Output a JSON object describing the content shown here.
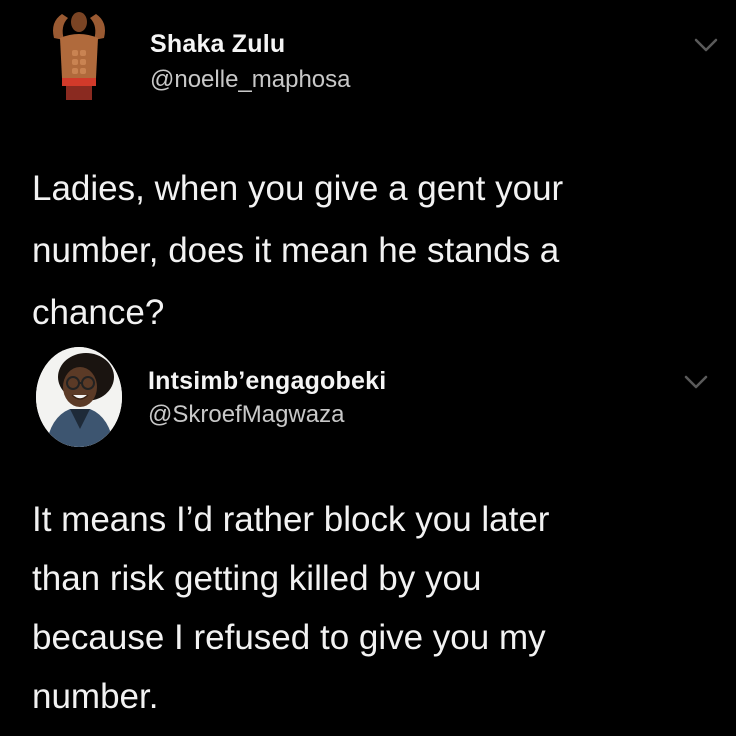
{
  "tweets": [
    {
      "display_name": "Shaka Zulu",
      "handle": "@noelle_maphosa",
      "text": "Ladies, when you give a gent your\nnumber, does it mean he stands a\nchance?",
      "avatar_icon": "shirtless-man-avatar",
      "menu_icon": "chevron-down-icon"
    },
    {
      "display_name": "Intsimb’engagobeki",
      "handle": "@SkroefMagwaza",
      "text": "It means I’d rather block you later\nthan risk getting killed by you\nbecause I refused to give you my\nnumber.",
      "avatar_icon": "smiling-woman-avatar",
      "menu_icon": "chevron-down-icon"
    }
  ],
  "colors": {
    "background": "#000000",
    "name": "#f5f5f5",
    "handle": "#c8c8c8",
    "text": "#f2f2f2",
    "chevron": "#5a5a5a"
  }
}
